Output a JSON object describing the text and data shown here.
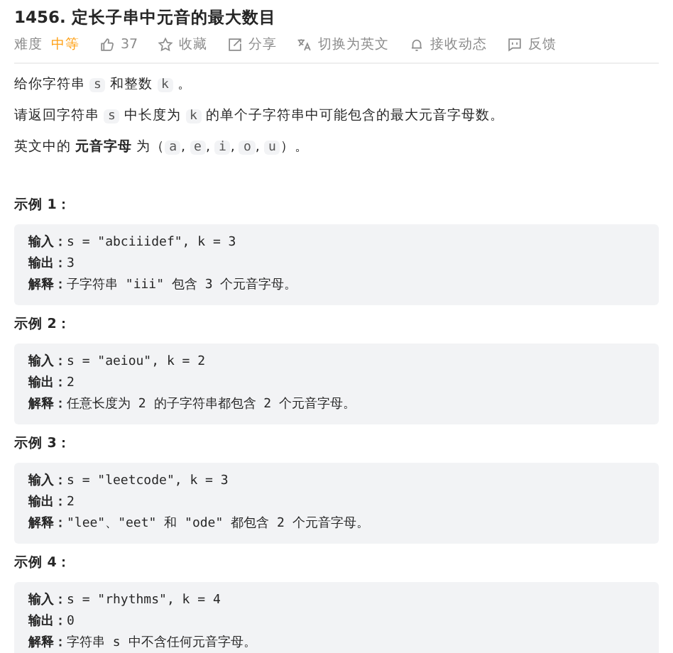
{
  "title": "1456. 定长子串中元音的最大数目",
  "toolbar": {
    "difficulty_label": "难度",
    "difficulty": "中等",
    "actions": [
      {
        "kind": "like",
        "label": "37"
      },
      {
        "kind": "star",
        "label": "收藏"
      },
      {
        "kind": "share",
        "label": "分享"
      },
      {
        "kind": "translate",
        "label": "切换为英文"
      },
      {
        "kind": "bell",
        "label": "接收动态"
      },
      {
        "kind": "feedback",
        "label": "反馈"
      }
    ]
  },
  "description": [
    [
      {
        "kind": "text",
        "text": "给你字符串 "
      },
      {
        "kind": "code",
        "text": "s"
      },
      {
        "kind": "text",
        "text": " 和整数 "
      },
      {
        "kind": "code",
        "text": "k"
      },
      {
        "kind": "text",
        "text": " 。"
      }
    ],
    [
      {
        "kind": "text",
        "text": "请返回字符串 "
      },
      {
        "kind": "code",
        "text": "s"
      },
      {
        "kind": "text",
        "text": " 中长度为 "
      },
      {
        "kind": "code",
        "text": "k"
      },
      {
        "kind": "text",
        "text": " 的单个子字符串中可能包含的最大元音字母数。"
      }
    ],
    [
      {
        "kind": "text",
        "text": "英文中的 **元音字母** 为（"
      },
      {
        "kind": "code",
        "text": "a"
      },
      {
        "kind": "text",
        "text": ", "
      },
      {
        "kind": "code",
        "text": "e"
      },
      {
        "kind": "text",
        "text": ", "
      },
      {
        "kind": "code",
        "text": "i"
      },
      {
        "kind": "text",
        "text": ", "
      },
      {
        "kind": "code",
        "text": "o"
      },
      {
        "kind": "text",
        "text": ", "
      },
      {
        "kind": "code",
        "text": "u"
      },
      {
        "kind": "text",
        "text": "）。"
      }
    ]
  ],
  "examples": [
    {
      "title": "示例 1：",
      "lines": [
        "**输入：**s = \"abciiidef\", k = 3",
        "**输出：**3",
        "**解释：**子字符串 \"iii\" 包含 3 个元音字母。"
      ]
    },
    {
      "title": "示例 2：",
      "lines": [
        "**输入：**s = \"aeiou\", k = 2",
        "**输出：**2",
        "**解释：**任意长度为 2 的子字符串都包含 2 个元音字母。"
      ]
    },
    {
      "title": "示例 3：",
      "lines": [
        "**输入：**s = \"leetcode\", k = 3",
        "**输出：**2",
        "**解释：**\"lee\"、\"eet\" 和 \"ode\" 都包含 2 个元音字母。"
      ]
    },
    {
      "title": "示例 4：",
      "lines": [
        "**输入：**s = \"rhythms\", k = 4",
        "**输出：**0",
        "**解释：**字符串 s 中不含任何元音字母。"
      ]
    }
  ]
}
